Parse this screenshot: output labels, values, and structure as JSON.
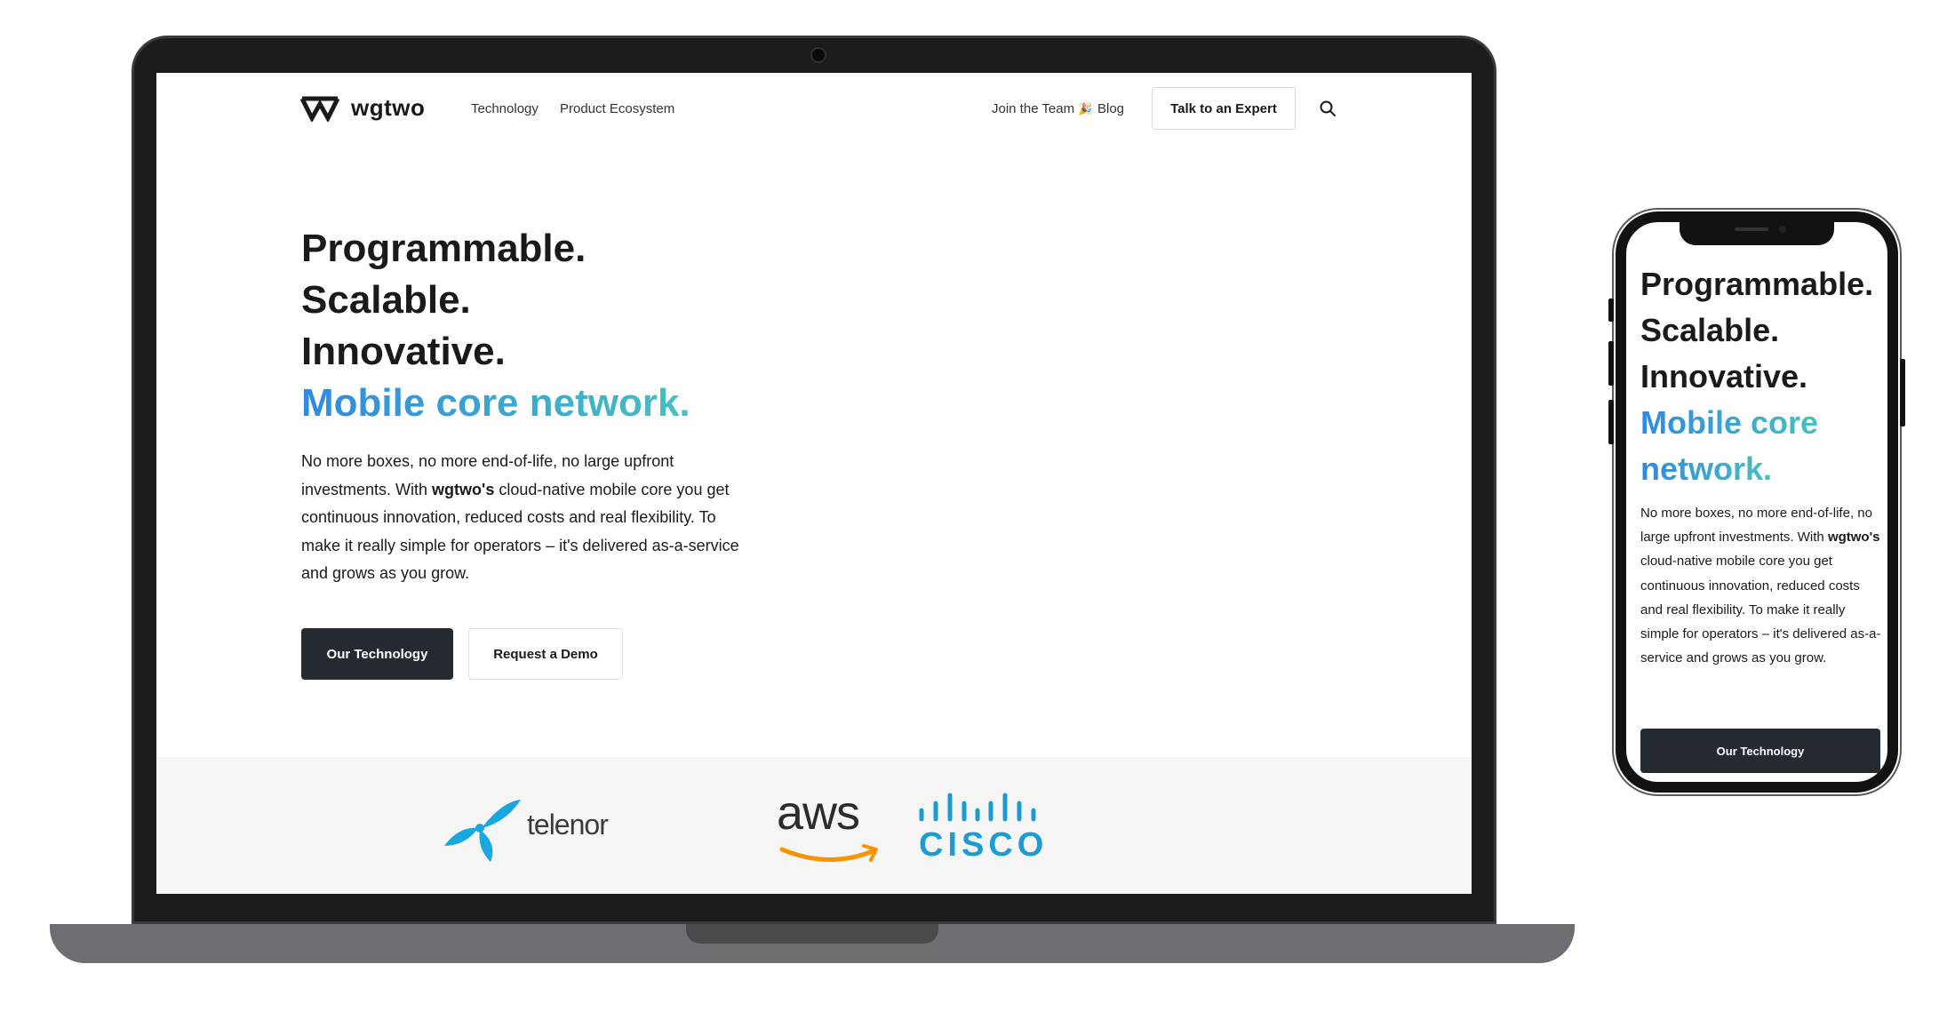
{
  "brand": {
    "name": "wgtwo",
    "logo_icon": "wgtwo-w-logo-icon"
  },
  "nav": {
    "left_links": [
      "Technology",
      "Product Ecosystem"
    ],
    "right_links": [
      "Join the Team",
      "Blog"
    ],
    "join_emoji": "🎉",
    "cta": "Talk to an Expert",
    "search_icon": "search-icon"
  },
  "hero": {
    "lines": [
      "Programmable.",
      "Scalable.",
      "Innovative."
    ],
    "accent": "Mobile core network.",
    "body_before": "No more boxes, no more end-of-life, no large upfront investments. With ",
    "body_bold": "wgtwo's",
    "body_after": " cloud-native mobile core you get continuous innovation, reduced costs and real flexibility. To make it really simple for operators – it's delivered as-a-service and grows as you grow.",
    "primary_button": "Our Technology",
    "secondary_button": "Request a Demo"
  },
  "partners": [
    "telenor",
    "aws",
    "cisco"
  ],
  "mobile": {
    "accent_line1": "Mobile core",
    "accent_line2": "network."
  },
  "colors": {
    "accent_start": "#2f8ae3",
    "accent_end": "#46c1bf",
    "dark_button": "#252a31",
    "telenor_blue": "#19a7e0",
    "aws_orange": "#f79400",
    "cisco_blue": "#1d9cd3"
  }
}
